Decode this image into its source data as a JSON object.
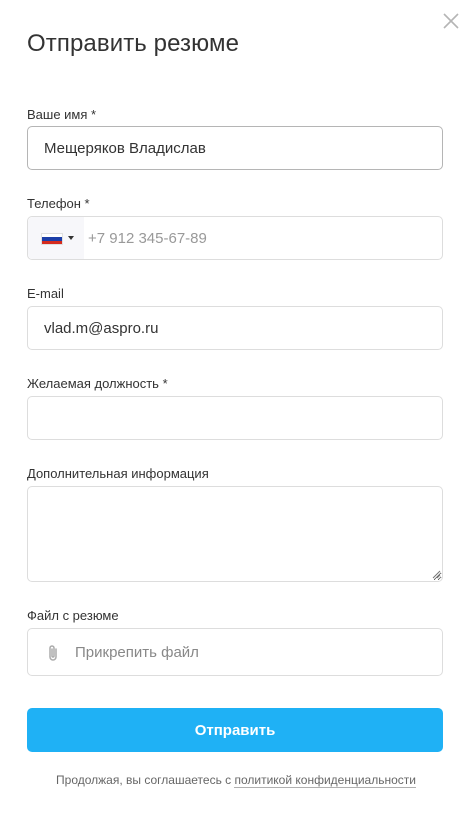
{
  "dialog": {
    "title": "Отправить резюме"
  },
  "icons": {
    "close": "close-icon",
    "flag": "russia-flag-icon",
    "caret": "caret-down-icon",
    "attach": "paperclip-icon"
  },
  "form": {
    "name": {
      "label": "Ваше имя *",
      "value": "Мещеряков Владислав"
    },
    "phone": {
      "label": "Телефон *",
      "value": "",
      "placeholder": "+7 912 345-67-89",
      "country": "RU"
    },
    "email": {
      "label": "E-mail",
      "value": "vlad.m@aspro.ru"
    },
    "position": {
      "label": "Желаемая должность *",
      "value": ""
    },
    "info": {
      "label": "Дополнительная информация",
      "value": ""
    },
    "file": {
      "label": "Файл с резюме",
      "button_text": "Прикрепить файл"
    },
    "submit_label": "Отправить"
  },
  "consent": {
    "text": "Продолжая, вы соглашаетесь с ",
    "link": "политикой конфиденциальности"
  },
  "colors": {
    "accent": "#1fb1f5",
    "border": "#dddddd",
    "text": "#333333",
    "placeholder": "#999999",
    "flag_white": "#ffffff",
    "flag_blue": "#1c3fa8",
    "flag_red": "#d52b1e"
  }
}
